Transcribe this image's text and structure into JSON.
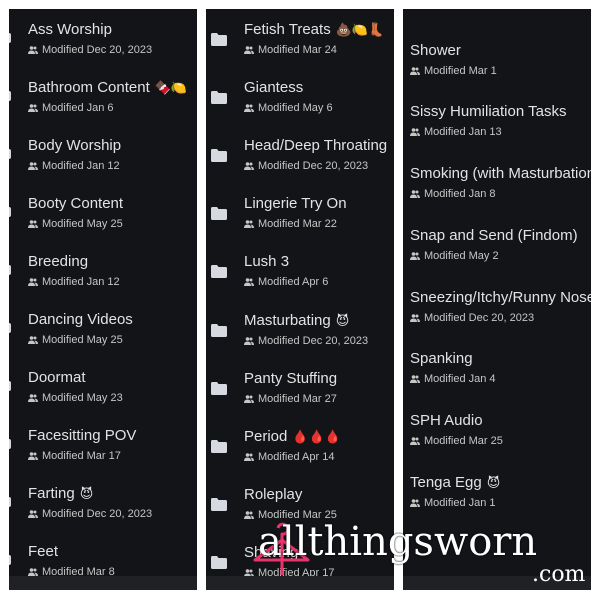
{
  "watermark": {
    "brand": "allthingsworn",
    "domain": ".com",
    "accent_color": "#e8336d"
  },
  "panels": [
    {
      "items": [
        {
          "name": "Ass Worship",
          "emoji": "",
          "modified": "Modified Dec 20, 2023"
        },
        {
          "name": "Bathroom Content",
          "emoji": "🍫🍋",
          "modified": "Modified Jan 6"
        },
        {
          "name": "Body Worship",
          "emoji": "",
          "modified": "Modified Jan 12"
        },
        {
          "name": "Booty Content",
          "emoji": "",
          "modified": "Modified May 25"
        },
        {
          "name": "Breeding",
          "emoji": "",
          "modified": "Modified Jan 12"
        },
        {
          "name": "Dancing Videos",
          "emoji": "",
          "modified": "Modified May 25"
        },
        {
          "name": "Doormat",
          "emoji": "",
          "modified": "Modified May 23"
        },
        {
          "name": "Facesitting POV",
          "emoji": "",
          "modified": "Modified Mar 17"
        },
        {
          "name": "Farting",
          "emoji": "😈",
          "modified": "Modified Dec 20, 2023"
        },
        {
          "name": "Feet",
          "emoji": "",
          "modified": "Modified Mar 8"
        }
      ]
    },
    {
      "items": [
        {
          "name": "Fetish Treats",
          "emoji": "💩🍋👢",
          "modified": "Modified Mar 24"
        },
        {
          "name": "Giantess",
          "emoji": "",
          "modified": "Modified May 6"
        },
        {
          "name": "Head/Deep Throating",
          "emoji": "",
          "modified": "Modified Dec 20, 2023"
        },
        {
          "name": "Lingerie Try On",
          "emoji": "",
          "modified": "Modified Mar 22"
        },
        {
          "name": "Lush 3",
          "emoji": "",
          "modified": "Modified Apr 6"
        },
        {
          "name": "Masturbating",
          "emoji": "😈",
          "modified": "Modified Dec 20, 2023"
        },
        {
          "name": "Panty Stuffing",
          "emoji": "",
          "modified": "Modified Mar 27"
        },
        {
          "name": "Period",
          "emoji": "🩸🩸🩸",
          "modified": "Modified Apr 14"
        },
        {
          "name": "Roleplay",
          "emoji": "",
          "modified": "Modified Mar 25"
        },
        {
          "name": "Shaving",
          "emoji": "",
          "modified": "Modified Apr 17"
        }
      ]
    },
    {
      "items": [
        {
          "name": "Shower",
          "emoji": "",
          "modified": "Modified Mar 1"
        },
        {
          "name": "Sissy Humiliation Tasks",
          "emoji": "",
          "modified": "Modified Jan 13"
        },
        {
          "name": "Smoking (with Masturbation",
          "emoji": "",
          "modified": "Modified Jan 8"
        },
        {
          "name": "Snap and Send (Findom)",
          "emoji": "",
          "modified": "Modified May 2"
        },
        {
          "name": "Sneezing/Itchy/Runny Nose",
          "emoji": "",
          "modified": "Modified Dec 20, 2023"
        },
        {
          "name": "Spanking",
          "emoji": "",
          "modified": "Modified Jan 4"
        },
        {
          "name": "SPH Audio",
          "emoji": "",
          "modified": "Modified Mar 25"
        },
        {
          "name": "Tenga Egg",
          "emoji": "😈",
          "modified": "Modified Jan 1"
        }
      ]
    }
  ]
}
